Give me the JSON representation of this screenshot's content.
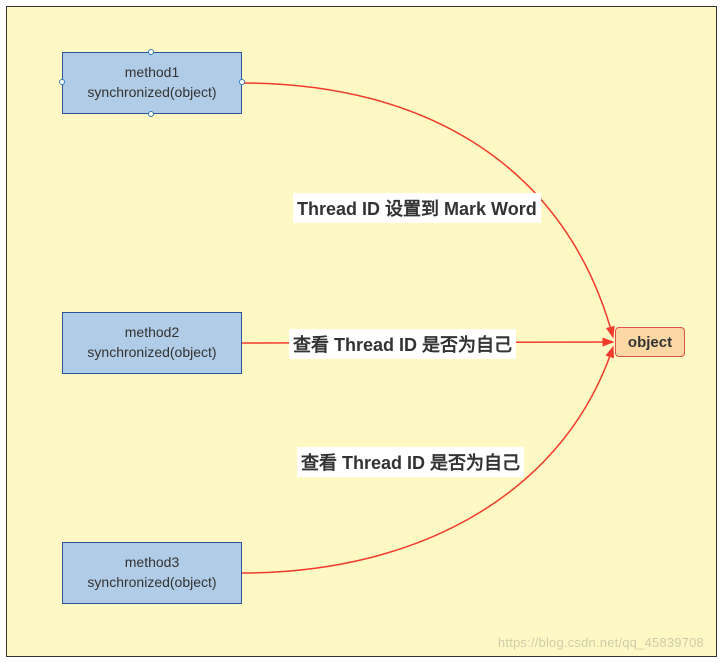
{
  "diagram": {
    "methods": [
      {
        "name": "method1",
        "lock": "synchronized(object)"
      },
      {
        "name": "method2",
        "lock": "synchronized(object)"
      },
      {
        "name": "method3",
        "lock": "synchronized(object)"
      }
    ],
    "target": {
      "label": "object"
    },
    "edges": [
      {
        "label": "Thread ID 设置到 Mark Word"
      },
      {
        "label": "查看 Thread ID 是否为自己"
      },
      {
        "label": "查看 Thread ID 是否为自己"
      }
    ]
  },
  "watermark": "https://blog.csdn.net/qq_45839708"
}
